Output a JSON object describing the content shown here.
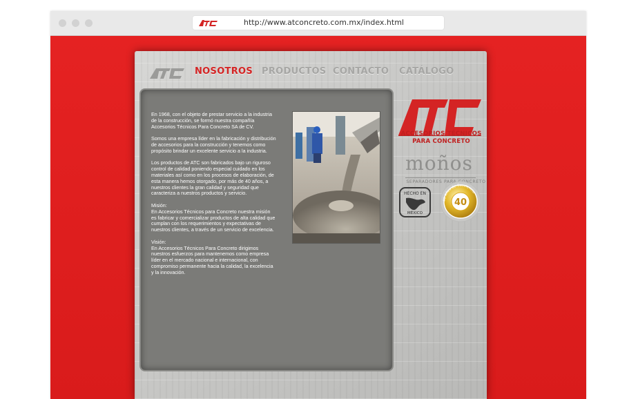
{
  "browser": {
    "url": "http://www.atconcreto.com.mx/index.html",
    "favicon_text": "ATC"
  },
  "nav": {
    "logo_text": "ATC",
    "items": [
      {
        "label": "NOSOTROS",
        "active": true
      },
      {
        "label": "PRODUCTOS",
        "active": false
      },
      {
        "label": "CONTACTO",
        "active": false
      },
      {
        "label": "CATÁLOGO",
        "active": false
      }
    ]
  },
  "content": {
    "paragraphs": [
      "En 1968, con el objeto de prestar servicio a la industria de la construcción, se formó nuestra compañía Accesorios Técnicos Para Concreto SA de CV.",
      "Somos una empresa líder en la fabricación y distribución de accesorios para la construcción y tenemos como propósito brindar un excelente servicio a la industria.",
      "Los productos de ATC son fabricados bajo un riguroso control de calidad poniendo especial cuidado en los materiales así como en los procesos de elaboración, de esta manera hemos otorgado, por más de 40 años, a nuestros clientes la gran calidad y seguridad que caracteriza a nuestros productos y servicio."
    ],
    "mision_title": "Misión:",
    "mision_text": "En Accesorios Técnicos para Concreto nuestra misión es fabricar y comercializar productos de alta calidad que cumplan con los requerimientos y expectativas de nuestros clientes, a través de un servicio de excelencia.",
    "vision_title": "Visión:",
    "vision_text": "En Accesorios Técnicos Para Concreto dirigimos nuestros esfuerzos para mantenemos como empresa líder en el mercado nacional e internacional, con compromiso permanente hacia la calidad, la excelencia y la innovación."
  },
  "brand": {
    "logo_text": "ATC",
    "subtitle_line1": "ACCESORIOS TÉCNICOS",
    "subtitle_line2": "PARA CONCRETO",
    "monos_title": "moños",
    "monos_subtitle": "SEPARADORES PARA CONCRETO",
    "hecho_en": "HECHO EN",
    "mexico": "MÉXICO",
    "anniversary_number": "40",
    "anniversary_ring": "40 Años de Excelencia"
  },
  "colors": {
    "brand_red": "#d42424",
    "page_red": "#e21f1f",
    "concrete": "#cfcfcd",
    "content_bg": "#7b7b78"
  }
}
